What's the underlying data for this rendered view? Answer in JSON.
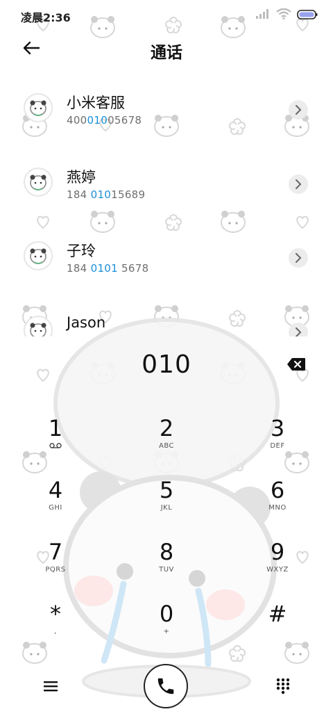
{
  "status_bar": {
    "time": "凌晨2:36",
    "icons": [
      "signal-icon",
      "wifi-icon",
      "battery-icon"
    ]
  },
  "header": {
    "back_icon": "back-arrow-icon",
    "title": "通话"
  },
  "contacts": [
    {
      "name": "小米客服",
      "number_pre": "400",
      "number_hl": "010",
      "number_post": "05678"
    },
    {
      "name": "燕婷",
      "number_pre": "184 ",
      "number_hl": "010",
      "number_post": "15689"
    },
    {
      "name": "子玲",
      "number_pre": "184 ",
      "number_hl": "0101",
      "number_post": " 5678"
    },
    {
      "name": "Jason",
      "number_pre": "",
      "number_hl": "",
      "number_post": ""
    }
  ],
  "dialer": {
    "number": "010",
    "backspace_icon": "backspace-icon"
  },
  "keypad": [
    {
      "digit": "1",
      "sub": "",
      "sub_icon": "voicemail-icon"
    },
    {
      "digit": "2",
      "sub": "ABC"
    },
    {
      "digit": "3",
      "sub": "DEF"
    },
    {
      "digit": "4",
      "sub": "GHI"
    },
    {
      "digit": "5",
      "sub": "JKL"
    },
    {
      "digit": "6",
      "sub": "MNO"
    },
    {
      "digit": "7",
      "sub": "PQRS"
    },
    {
      "digit": "8",
      "sub": "TUV"
    },
    {
      "digit": "9",
      "sub": "WXYZ"
    },
    {
      "digit": "*",
      "sub": ","
    },
    {
      "digit": "0",
      "sub": "+"
    },
    {
      "digit": "#",
      "sub": ""
    }
  ],
  "bottom_bar": {
    "menu_icon": "menu-icon",
    "call_icon": "phone-icon",
    "keypad_icon": "dialpad-icon"
  },
  "colors": {
    "highlight": "#1a8fd8",
    "text": "#111111",
    "secondary": "#6f6f6f"
  }
}
